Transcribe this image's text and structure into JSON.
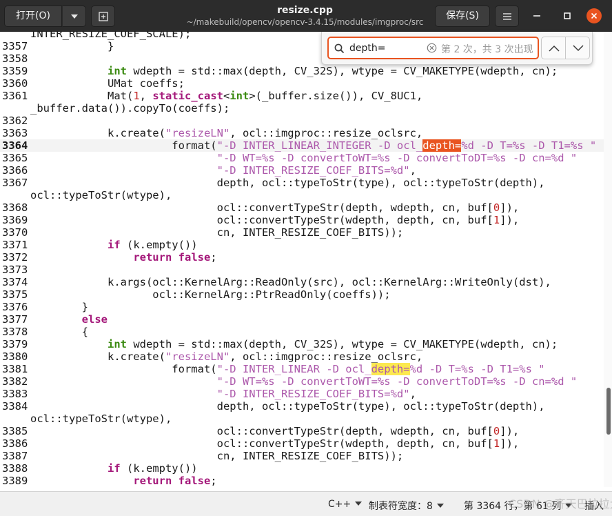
{
  "header": {
    "open_label": "打开(O)",
    "title": "resize.cpp",
    "path": "~/makebuild/opencv/opencv-3.4.15/modules/imgproc/src",
    "save_label": "保存(S)",
    "icons": {
      "open_menu": "chevron-down-icon",
      "new_tab": "new-document-icon",
      "menu": "hamburger-menu-icon",
      "minimize": "minimize-icon",
      "maximize": "maximize-icon",
      "close": "close-icon"
    }
  },
  "search": {
    "query": "depth=",
    "status": "第 2 次，共 3 次出现"
  },
  "code": {
    "lines": [
      {
        "n": "",
        "parts": [
          {
            "t": "INTER_RESIZE_COEF_SCALE);"
          }
        ]
      },
      {
        "n": "3357",
        "parts": [
          {
            "t": "            }"
          }
        ]
      },
      {
        "n": "3358",
        "parts": [
          {
            "t": ""
          }
        ]
      },
      {
        "n": "3359",
        "parts": [
          {
            "t": "            "
          },
          {
            "t": "int",
            "c": "ty"
          },
          {
            "t": " wdepth = std::max(depth, CV_32S), wtype = CV_MAKETYPE(wdepth, cn);"
          }
        ]
      },
      {
        "n": "3360",
        "parts": [
          {
            "t": "            UMat coeffs;"
          }
        ]
      },
      {
        "n": "3361",
        "parts": [
          {
            "t": "            Mat("
          },
          {
            "t": "1",
            "c": "num"
          },
          {
            "t": ", "
          },
          {
            "t": "static_cast",
            "c": "kw"
          },
          {
            "t": "<"
          },
          {
            "t": "int",
            "c": "ty"
          },
          {
            "t": ">(_buffer.size()), CV_8UC1,"
          }
        ]
      },
      {
        "n": "",
        "parts": [
          {
            "t": "_buffer.data()).copyTo(coeffs);"
          }
        ]
      },
      {
        "n": "3362",
        "parts": [
          {
            "t": ""
          }
        ]
      },
      {
        "n": "3363",
        "parts": [
          {
            "t": "            k.create("
          },
          {
            "t": "\"resizeLN\"",
            "c": "str"
          },
          {
            "t": ", ocl::imgproc::resize_oclsrc,"
          }
        ]
      },
      {
        "n": "3364",
        "current": true,
        "parts": [
          {
            "t": "                      format("
          },
          {
            "t": "\"-D INTER_LINEAR_INTEGER -D ocl_",
            "c": "str"
          },
          {
            "t": "depth=",
            "c": "hl-current"
          },
          {
            "t": "%d -D T=%s -D T1=%s \"",
            "c": "str"
          }
        ]
      },
      {
        "n": "3365",
        "parts": [
          {
            "t": "                             "
          },
          {
            "t": "\"-D WT=%s -D convertToWT=%s -D convertToDT=%s -D cn=%d \"",
            "c": "str"
          }
        ]
      },
      {
        "n": "3366",
        "parts": [
          {
            "t": "                             "
          },
          {
            "t": "\"-D INTER_RESIZE_COEF_BITS=%d\"",
            "c": "str"
          },
          {
            "t": ","
          }
        ]
      },
      {
        "n": "3367",
        "parts": [
          {
            "t": "                             depth, ocl::typeToStr(type), ocl::typeToStr(depth),"
          }
        ]
      },
      {
        "n": "",
        "parts": [
          {
            "t": "ocl::typeToStr(wtype),"
          }
        ]
      },
      {
        "n": "3368",
        "parts": [
          {
            "t": "                             ocl::convertTypeStr(depth, wdepth, cn, buf["
          },
          {
            "t": "0",
            "c": "num"
          },
          {
            "t": "]),"
          }
        ]
      },
      {
        "n": "3369",
        "parts": [
          {
            "t": "                             ocl::convertTypeStr(wdepth, depth, cn, buf["
          },
          {
            "t": "1",
            "c": "num"
          },
          {
            "t": "]),"
          }
        ]
      },
      {
        "n": "3370",
        "parts": [
          {
            "t": "                             cn, INTER_RESIZE_COEF_BITS));"
          }
        ]
      },
      {
        "n": "3371",
        "parts": [
          {
            "t": "            "
          },
          {
            "t": "if",
            "c": "kw"
          },
          {
            "t": " (k.empty())"
          }
        ]
      },
      {
        "n": "3372",
        "parts": [
          {
            "t": "                "
          },
          {
            "t": "return",
            "c": "kw"
          },
          {
            "t": " "
          },
          {
            "t": "false",
            "c": "kw"
          },
          {
            "t": ";"
          }
        ]
      },
      {
        "n": "3373",
        "parts": [
          {
            "t": ""
          }
        ]
      },
      {
        "n": "3374",
        "parts": [
          {
            "t": "            k.args(ocl::KernelArg::ReadOnly(src), ocl::KernelArg::WriteOnly(dst),"
          }
        ]
      },
      {
        "n": "3375",
        "parts": [
          {
            "t": "                   ocl::KernelArg::PtrReadOnly(coeffs));"
          }
        ]
      },
      {
        "n": "3376",
        "parts": [
          {
            "t": "        }"
          }
        ]
      },
      {
        "n": "3377",
        "parts": [
          {
            "t": "        "
          },
          {
            "t": "else",
            "c": "kw"
          }
        ]
      },
      {
        "n": "3378",
        "parts": [
          {
            "t": "        {"
          }
        ]
      },
      {
        "n": "3379",
        "parts": [
          {
            "t": "            "
          },
          {
            "t": "int",
            "c": "ty"
          },
          {
            "t": " wdepth = std::max(depth, CV_32S), wtype = CV_MAKETYPE(wdepth, cn);"
          }
        ]
      },
      {
        "n": "3380",
        "parts": [
          {
            "t": "            k.create("
          },
          {
            "t": "\"resizeLN\"",
            "c": "str"
          },
          {
            "t": ", ocl::imgproc::resize_oclsrc,"
          }
        ]
      },
      {
        "n": "3381",
        "parts": [
          {
            "t": "                      format("
          },
          {
            "t": "\"-D INTER_LINEAR -D ocl_",
            "c": "str"
          },
          {
            "t": "depth=",
            "c": "hl-match str"
          },
          {
            "t": "%d -D T=%s -D T1=%s \"",
            "c": "str"
          }
        ]
      },
      {
        "n": "3382",
        "parts": [
          {
            "t": "                             "
          },
          {
            "t": "\"-D WT=%s -D convertToWT=%s -D convertToDT=%s -D cn=%d \"",
            "c": "str"
          }
        ]
      },
      {
        "n": "3383",
        "parts": [
          {
            "t": "                             "
          },
          {
            "t": "\"-D INTER_RESIZE_COEF_BITS=%d\"",
            "c": "str"
          },
          {
            "t": ","
          }
        ]
      },
      {
        "n": "3384",
        "parts": [
          {
            "t": "                             depth, ocl::typeToStr(type), ocl::typeToStr(depth),"
          }
        ]
      },
      {
        "n": "",
        "parts": [
          {
            "t": "ocl::typeToStr(wtype),"
          }
        ]
      },
      {
        "n": "3385",
        "parts": [
          {
            "t": "                             ocl::convertTypeStr(depth, wdepth, cn, buf["
          },
          {
            "t": "0",
            "c": "num"
          },
          {
            "t": "]),"
          }
        ]
      },
      {
        "n": "3386",
        "parts": [
          {
            "t": "                             ocl::convertTypeStr(wdepth, depth, cn, buf["
          },
          {
            "t": "1",
            "c": "num"
          },
          {
            "t": "]),"
          }
        ]
      },
      {
        "n": "3387",
        "parts": [
          {
            "t": "                             cn, INTER_RESIZE_COEF_BITS));"
          }
        ]
      },
      {
        "n": "3388",
        "parts": [
          {
            "t": "            "
          },
          {
            "t": "if",
            "c": "kw"
          },
          {
            "t": " (k.empty())"
          }
        ]
      },
      {
        "n": "3389",
        "parts": [
          {
            "t": "                "
          },
          {
            "t": "return",
            "c": "kw"
          },
          {
            "t": " "
          },
          {
            "t": "false",
            "c": "kw"
          },
          {
            "t": ";"
          }
        ]
      },
      {
        "n": "3390",
        "parts": [
          {
            "t": ""
          }
        ]
      }
    ]
  },
  "statusbar": {
    "language": "C++",
    "tab_width": "制表符宽度：8",
    "position": "第 3364 行，第 61 列",
    "insert_mode": "插入"
  },
  "watermark": "CSDN @齐天巴拉拉大"
}
